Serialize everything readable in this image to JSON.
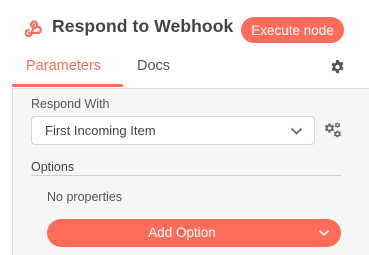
{
  "node": {
    "title": "Respond to Webhook",
    "icon": "webhook-icon",
    "execute_label": "Execute node"
  },
  "tabs": {
    "items": [
      {
        "label": "Parameters",
        "active": true
      },
      {
        "label": "Docs",
        "active": false
      }
    ],
    "settings_icon": "gear-icon"
  },
  "parameters": {
    "respond_with": {
      "label": "Respond With",
      "value": "First Incoming Item",
      "icon": "chevron-down-icon",
      "options_icon": "cogs-icon"
    },
    "options": {
      "label": "Options",
      "empty_text": "No properties",
      "add_label": "Add Option",
      "add_icon": "chevron-down-icon"
    }
  },
  "colors": {
    "accent": "#ff6d5a",
    "content_bg": "#f6f6f7",
    "text": "#444446"
  }
}
